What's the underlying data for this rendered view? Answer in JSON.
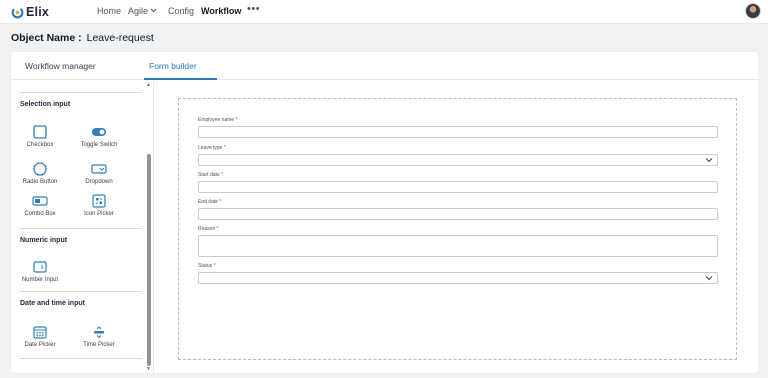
{
  "brand": {
    "name": "Elix",
    "icon": "elix-logo-icon"
  },
  "nav": {
    "items": [
      {
        "label": "Home"
      },
      {
        "label": "Agile",
        "icon": "chevron-down-icon"
      },
      {
        "label": "Config"
      },
      {
        "label": "Workflow",
        "active": true
      }
    ],
    "more": "•••",
    "avatar": "user-avatar"
  },
  "object": {
    "label": "Object Name :",
    "value": "Leave-request"
  },
  "tabs": [
    {
      "label": "Workflow manager",
      "active": false
    },
    {
      "label": "Form builder",
      "active": true
    }
  ],
  "palette": {
    "selection": {
      "title": "Selection input",
      "items": [
        {
          "label": "Checkbox",
          "icon": "checkbox-icon"
        },
        {
          "label": "Toggle Switch",
          "icon": "toggle-switch-icon"
        },
        {
          "label": "Radio Button",
          "icon": "radio-button-icon"
        },
        {
          "label": "Dropdown",
          "icon": "dropdown-icon"
        },
        {
          "label": "Combo Box",
          "icon": "combo-box-icon"
        },
        {
          "label": "Icon Picker",
          "icon": "icon-picker-icon"
        }
      ]
    },
    "numeric": {
      "title": "Numeric input",
      "items": [
        {
          "label": "Number Input",
          "icon": "number-input-icon"
        }
      ]
    },
    "datetime": {
      "title": "Date and time input",
      "items": [
        {
          "label": "Date Picker",
          "icon": "calendar-icon"
        },
        {
          "label": "Time Picker",
          "icon": "time-picker-icon"
        }
      ]
    }
  },
  "form": {
    "required_mark": "*",
    "fields": [
      {
        "label": "Employee name",
        "type": "text",
        "value": ""
      },
      {
        "label": "Leave type",
        "type": "select",
        "value": ""
      },
      {
        "label": "Start date",
        "type": "text",
        "value": ""
      },
      {
        "label": "End date",
        "type": "text",
        "value": ""
      },
      {
        "label": "Reason",
        "type": "textarea",
        "value": ""
      },
      {
        "label": "Status",
        "type": "select",
        "value": ""
      }
    ]
  },
  "colors": {
    "accent": "#2b7bbf",
    "required": "#d14343",
    "icon": "#2f7fbd"
  }
}
